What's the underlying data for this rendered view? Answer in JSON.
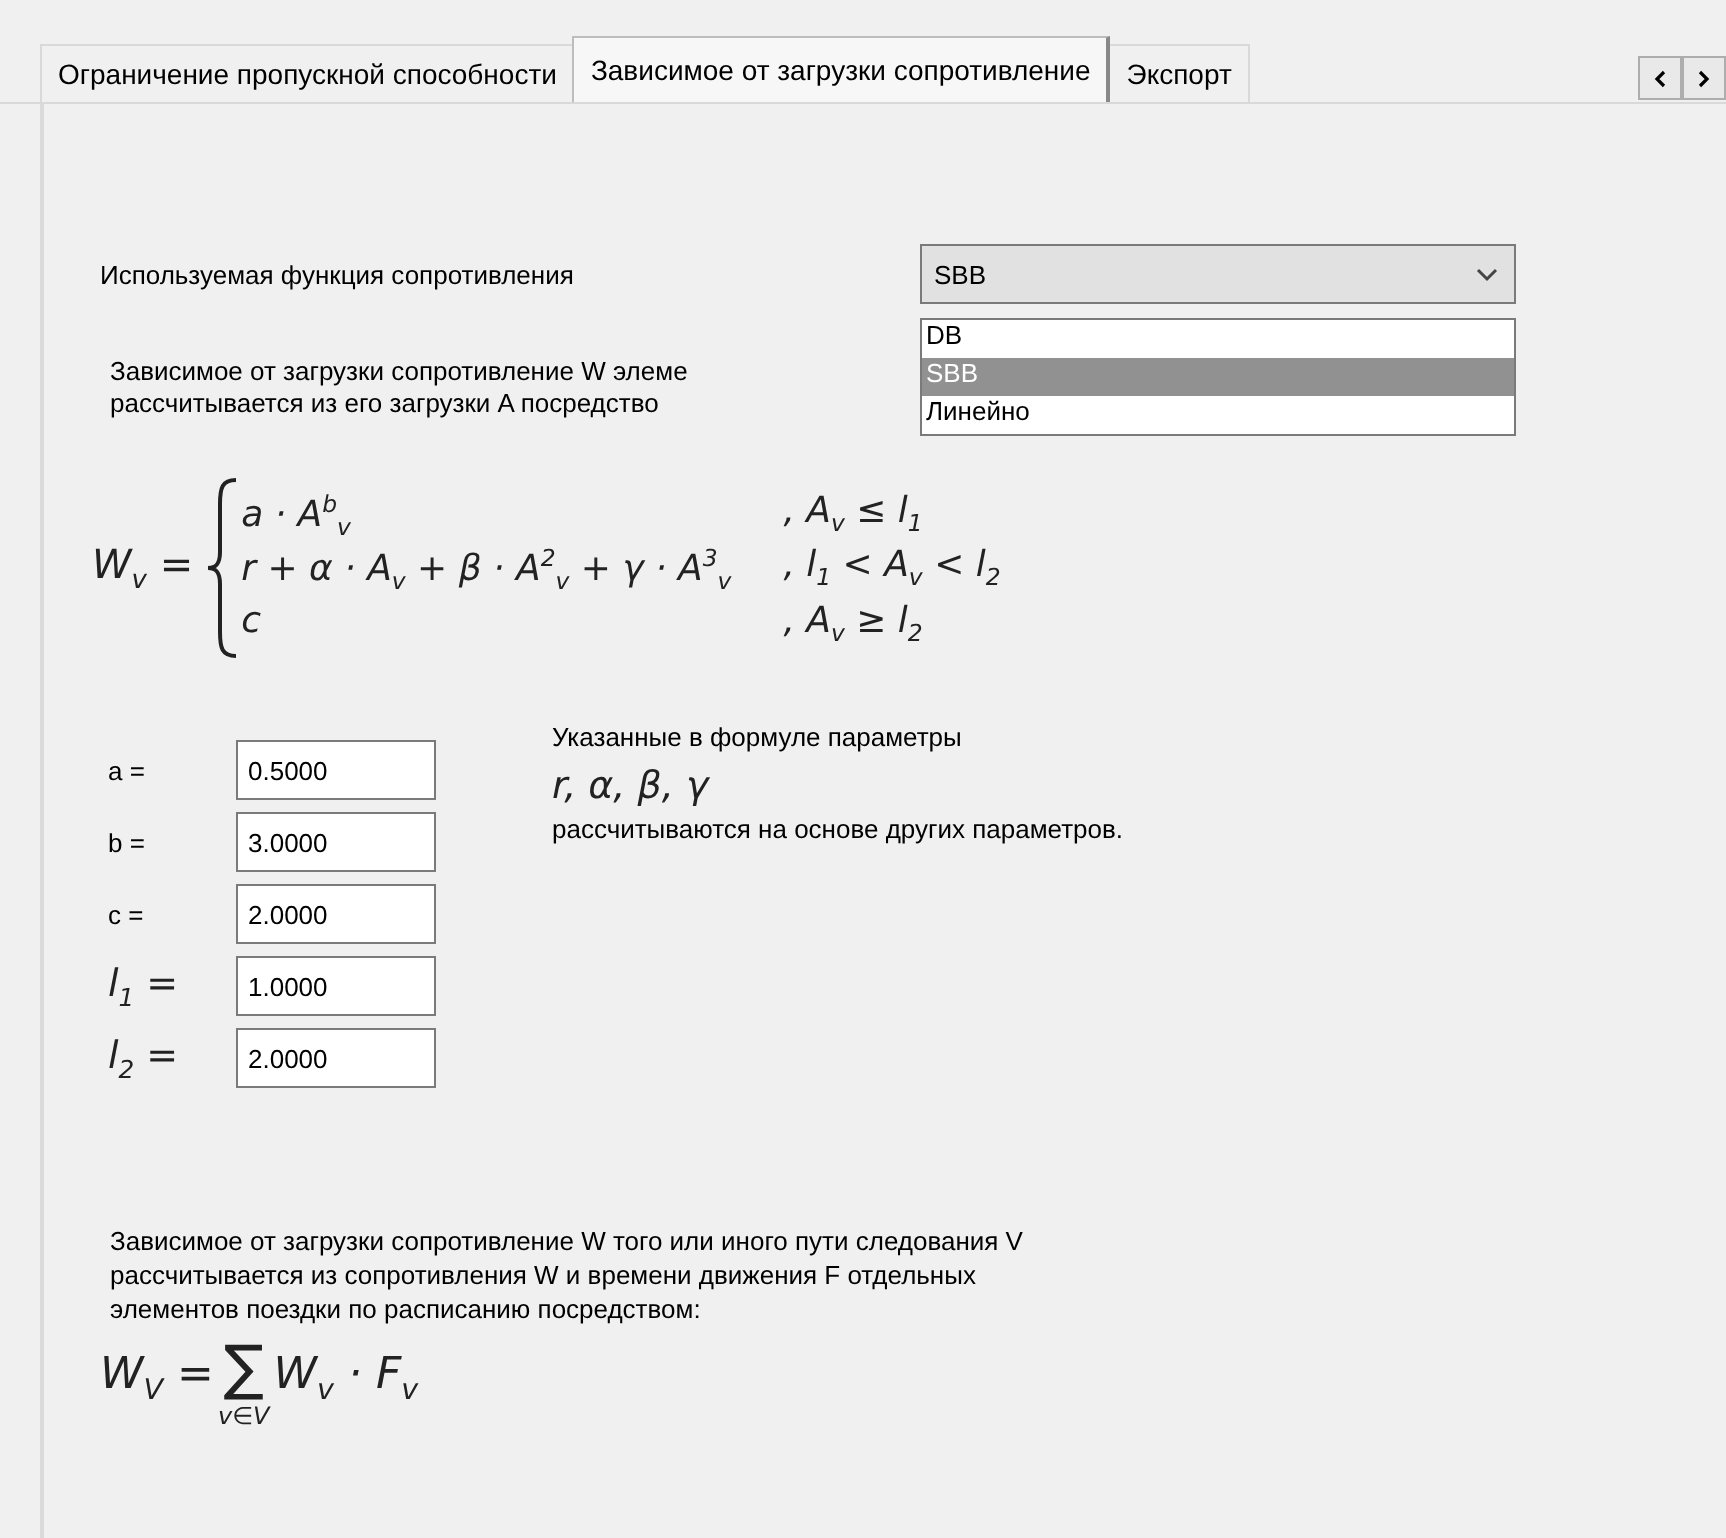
{
  "tabs": [
    {
      "label": "Ограничение пропускной способности",
      "selected": false
    },
    {
      "label": "Зависимое от загрузки сопротивление",
      "selected": true
    },
    {
      "label": "Экспорт",
      "selected": false
    }
  ],
  "function_select": {
    "label": "Используемая функция сопротивления",
    "value": "SBB",
    "expanded": true,
    "options": [
      {
        "label": "DB",
        "selected": false
      },
      {
        "label": "SBB",
        "selected": true
      },
      {
        "label": "Линейно",
        "selected": false
      }
    ]
  },
  "description_lines": [
    "Зависимое от загрузки сопротивление W элеме",
    "рассчитывается из его загрузки A посредство"
  ],
  "formula": {
    "lhs": "W$_{v}$ =",
    "cases": [
      {
        "expression": "a · A$^{b}$$_{v}$",
        "condition": ", A$_{v}$ ≤ l$_{1}$"
      },
      {
        "expression": "r + α · A$_{v}$ + β · A$^{2}$$_{v}$ + γ · A$^{3}$$_{v}$",
        "condition": ", l$_{1}$ < A$_{v}$ < l$_{2}$"
      },
      {
        "expression": "c",
        "condition": ", A$_{v}$ ≥ l$_{2}$"
      }
    ]
  },
  "parameters": [
    {
      "kind": "text",
      "label": "a =",
      "value": "0.5000"
    },
    {
      "kind": "text",
      "label": "b =",
      "value": "3.0000"
    },
    {
      "kind": "text",
      "label": "c =",
      "value": "2.0000"
    },
    {
      "kind": "math",
      "label": "l$_{1}$ =",
      "value": "1.0000"
    },
    {
      "kind": "math",
      "label": "l$_{2}$ =",
      "value": "2.0000"
    }
  ],
  "note": {
    "line_1": "Указанные в формуле параметры",
    "symbols": "r, α, β, γ",
    "line_2": "рассчитываются на основе других параметров."
  },
  "route_lines": [
    "Зависимое от загрузки сопротивление W того или иного пути следования V",
    "рассчитывается из сопротивления W и времени движения F отдельных",
    "элементов поездки по расписанию посредством:"
  ],
  "sum_formula": {
    "lhs": "W$_{V}$ =",
    "operator": "∑",
    "range": "v∈V",
    "term": "W$_{v}$ · F$_{v}$"
  }
}
